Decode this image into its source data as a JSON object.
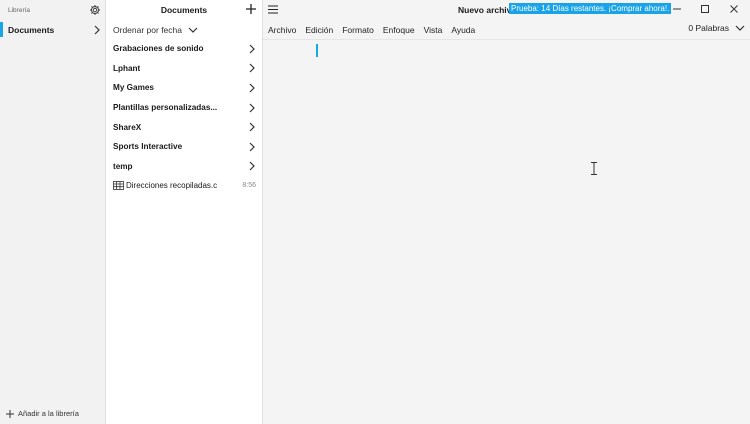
{
  "library": {
    "title": "Librería",
    "items": [
      {
        "label": "Documents"
      }
    ],
    "add_label": "Añadir a la librería"
  },
  "documents": {
    "title": "Documents",
    "sort_label": "Ordenar por fecha",
    "folders": [
      "Grabaciones de sonido",
      "Lphant",
      "My Games",
      "Plantillas personalizadas...",
      "ShareX",
      "Sports Interactive",
      "temp"
    ],
    "files": [
      {
        "name": "Direcciones recopiladas.c",
        "time": "8:56"
      }
    ]
  },
  "editor": {
    "doc_title": "Nuevo archivo",
    "trial_banner": "Prueba: 14 Días restantes. ¡Comprar ahora!.",
    "menu": [
      "Archivo",
      "Edición",
      "Formato",
      "Enfoque",
      "Vista",
      "Ayuda"
    ],
    "word_count": "0 Palabras"
  },
  "colors": {
    "accent": "#1aa3e8"
  }
}
